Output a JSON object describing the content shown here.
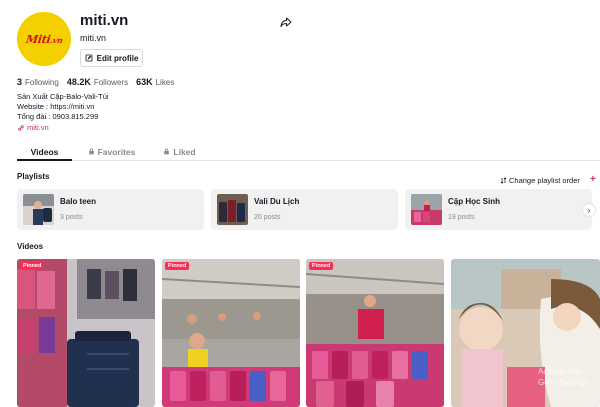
{
  "profile": {
    "avatar_logo_main": "Miti",
    "avatar_logo_tld": ".vn",
    "username": "miti.vn",
    "nickname": "miti.vn",
    "edit_button": "Edit profile",
    "share_icon": "share-arrow-icon"
  },
  "stats": {
    "following_count": "3",
    "following_label": "Following",
    "followers_count": "48.2K",
    "followers_label": "Followers",
    "likes_count": "63K",
    "likes_label": "Likes"
  },
  "bio": {
    "line1": "Sản Xuất Cặp-Balo-Vali-Túi",
    "line2": "Website : https://miti.vn",
    "line3": "Tổng đài : 0903.815.299",
    "link": "miti.vn"
  },
  "tabs": [
    {
      "label": "Videos",
      "active": true
    },
    {
      "label": "Favorites",
      "active": false,
      "icon": "lock-icon"
    },
    {
      "label": "Liked",
      "active": false,
      "icon": "lock-icon"
    }
  ],
  "playlists": {
    "label": "Playlists",
    "change_label": "Change playlist order",
    "add_icon": "+",
    "next_icon": "›",
    "items": [
      {
        "name": "Balo teen",
        "count": "3 posts"
      },
      {
        "name": "Vali Du Lịch",
        "count": "20 posts"
      },
      {
        "name": "Cặp Học Sinh",
        "count": "19 posts"
      }
    ]
  },
  "videos": {
    "label": "Videos",
    "items": [
      {
        "badge": "Pinned"
      },
      {
        "badge": "Pinned"
      },
      {
        "badge": "Pinned"
      },
      {
        "badge": ""
      }
    ]
  },
  "watermark": {
    "line1": "Activate Win",
    "line2": "Go to Settings"
  },
  "colors": {
    "accent": "#fe2c55",
    "link": "#d0304b",
    "avatar_bg": "#f5d000",
    "logo_red": "#d0121b"
  }
}
